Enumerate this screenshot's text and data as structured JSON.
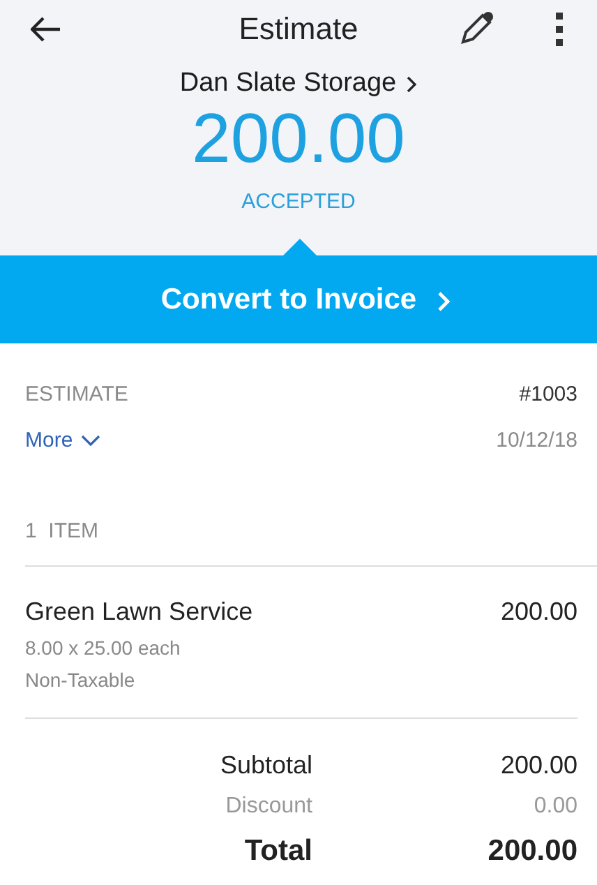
{
  "app_bar": {
    "title": "Estimate"
  },
  "summary": {
    "customer": "Dan Slate Storage",
    "amount": "200.00",
    "status": "ACCEPTED"
  },
  "convert_button": {
    "label": "Convert to Invoice"
  },
  "details": {
    "label": "ESTIMATE",
    "number": "#1003",
    "more_link": "More",
    "date": "10/12/18"
  },
  "items_header": "1  ITEM",
  "items": [
    {
      "name": "Green Lawn Service",
      "amount": "200.00",
      "quantity_line": "8.00 x 25.00 each",
      "tax": "Non-Taxable"
    }
  ],
  "totals": [
    {
      "kind": "subtotal",
      "label": "Subtotal",
      "value": "200.00"
    },
    {
      "kind": "discount",
      "label": "Discount",
      "value": "0.00"
    },
    {
      "kind": "total",
      "label": "Total",
      "value": "200.00"
    }
  ]
}
